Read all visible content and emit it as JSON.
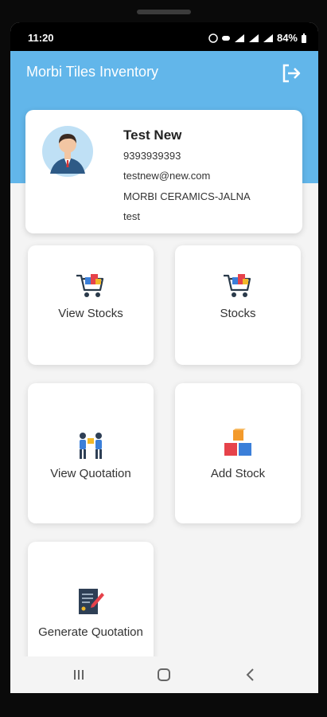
{
  "status_bar": {
    "time": "11:20",
    "battery": "84%"
  },
  "app_bar": {
    "title": "Morbi Tiles Inventory",
    "logout_icon": "logout-icon"
  },
  "profile": {
    "name": "Test New",
    "phone": "9393939393",
    "email": "testnew@new.com",
    "company": "MORBI CERAMICS-JALNA",
    "note": "test"
  },
  "tiles": [
    {
      "label": "View Stocks",
      "icon": "shopping-cart-icon"
    },
    {
      "label": "Stocks",
      "icon": "shopping-cart-icon"
    },
    {
      "label": "View Quotation",
      "icon": "people-exchange-icon"
    },
    {
      "label": "Add Stock",
      "icon": "boxes-icon"
    },
    {
      "label": "Generate Quotation",
      "icon": "document-pen-icon"
    }
  ],
  "colors": {
    "app_bar": "#62b6ea",
    "background": "#f4f4f4"
  }
}
